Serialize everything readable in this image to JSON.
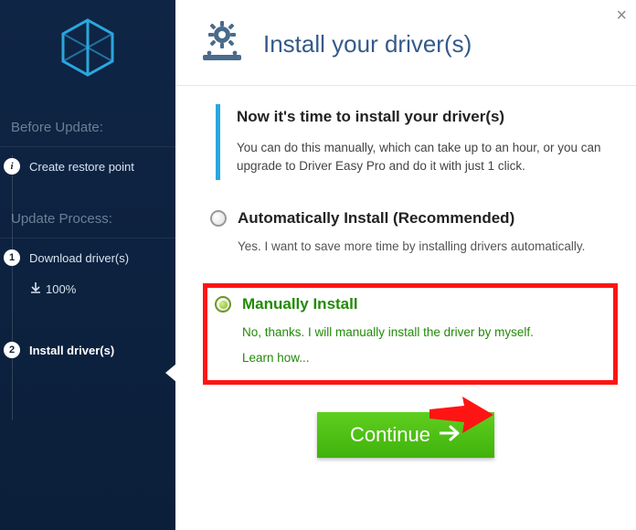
{
  "header": {
    "title": "Install your driver(s)"
  },
  "sidebar": {
    "section1": "Before Update:",
    "step_restore": "Create restore point",
    "section2": "Update Process:",
    "step_download": "Download driver(s)",
    "download_progress": "100%",
    "step_install": "Install driver(s)"
  },
  "intro": {
    "heading": "Now it's time to install your driver(s)",
    "body": "You can do this manually, which can take up to an hour, or you can upgrade to Driver Easy Pro and do it with just 1 click."
  },
  "options": {
    "auto": {
      "title": "Automatically Install (Recommended)",
      "sub": "Yes. I want to save more time by installing drivers automatically."
    },
    "manual": {
      "title": "Manually Install",
      "sub": "No, thanks. I will manually install the driver by myself.",
      "learn": "Learn how..."
    }
  },
  "buttons": {
    "continue": "Continue"
  },
  "close": "×"
}
